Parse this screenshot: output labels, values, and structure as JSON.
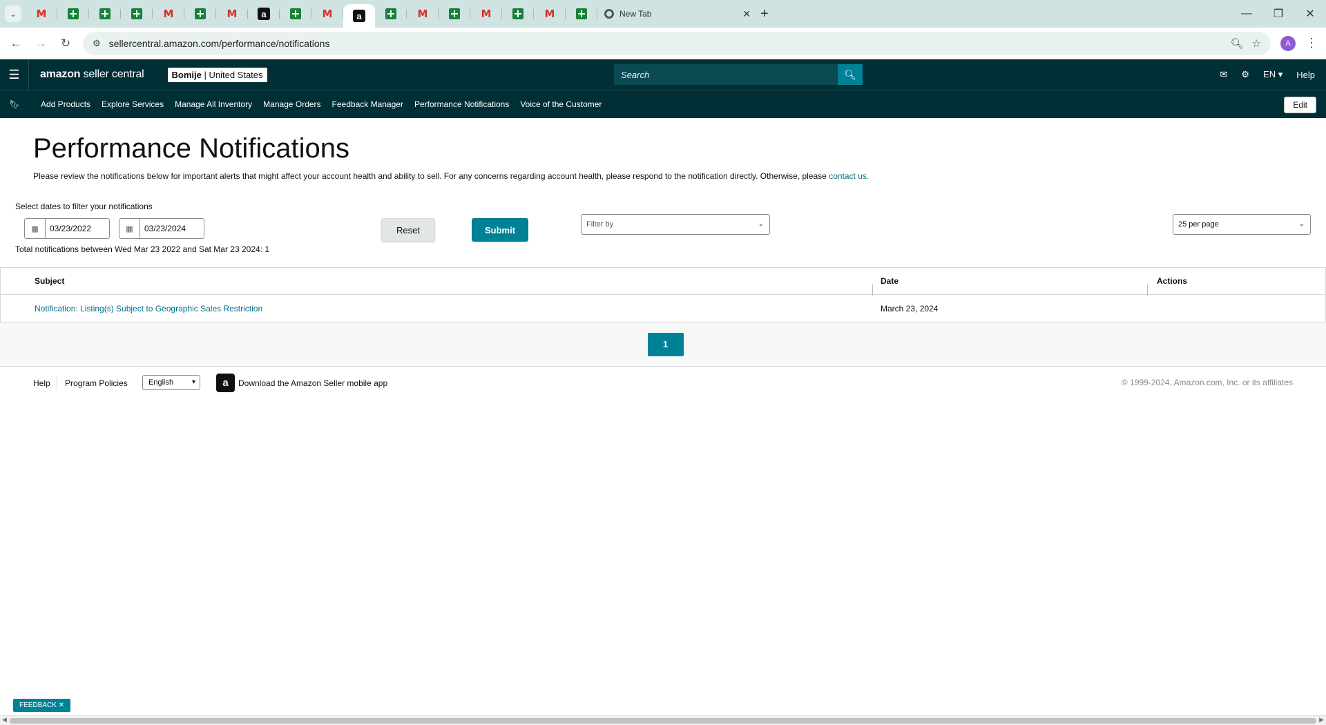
{
  "browser": {
    "tabs": [
      {
        "icon": "gmail-icon"
      },
      {
        "icon": "sheets-icon"
      },
      {
        "icon": "sheets-icon"
      },
      {
        "icon": "sheets-icon"
      },
      {
        "icon": "gmail-icon"
      },
      {
        "icon": "sheets-icon"
      },
      {
        "icon": "gmail-icon"
      },
      {
        "icon": "amazon-icon"
      },
      {
        "icon": "sheets-icon"
      },
      {
        "icon": "gmail-icon"
      },
      {
        "icon": "amazon-icon",
        "active": true
      },
      {
        "icon": "sheets-icon"
      },
      {
        "icon": "gmail-icon"
      },
      {
        "icon": "sheets-icon"
      },
      {
        "icon": "gmail-icon"
      },
      {
        "icon": "sheets-icon"
      },
      {
        "icon": "gmail-icon"
      },
      {
        "icon": "sheets-icon"
      }
    ],
    "new_tab_label": "New Tab",
    "url": "sellercentral.amazon.com/performance/notifications",
    "avatar_letter": "A"
  },
  "header": {
    "logo_bold": "amazon",
    "logo_light": " seller central",
    "account_store": "Bomije",
    "account_region": " | United States",
    "search_placeholder": "Search",
    "language": "EN",
    "help": "Help"
  },
  "nav": {
    "links": [
      "Add Products",
      "Explore Services",
      "Manage All Inventory",
      "Manage Orders",
      "Feedback Manager",
      "Performance Notifications",
      "Voice of the Customer"
    ],
    "edit_label": "Edit"
  },
  "page": {
    "title": "Performance Notifications",
    "intro": "Please review the notifications below for important alerts that might affect your account health and ability to sell. For any concerns regarding account health, please respond to the notification directly. Otherwise, please ",
    "intro_link": "contact us."
  },
  "filters": {
    "label": "Select dates to filter your notifications",
    "start_date": "03/23/2022",
    "end_date": "03/23/2024",
    "reset_label": "Reset",
    "submit_label": "Submit",
    "filter_placeholder": "Filter by",
    "per_page": "25 per page",
    "total_text": "Total notifications between Wed Mar 23 2022 and Sat Mar 23 2024: 1"
  },
  "table": {
    "columns": [
      "Subject",
      "Date",
      "Actions"
    ],
    "rows": [
      {
        "subject": "Notification: Listing(s) Subject to Geographic Sales Restriction",
        "date": "March 23, 2024",
        "actions": ""
      }
    ]
  },
  "pagination": {
    "current": "1"
  },
  "footer": {
    "help": "Help",
    "policies": "Program Policies",
    "language": "English",
    "app_text": "Download the Amazon Seller mobile app",
    "copyright": "© 1999-2024, Amazon.com, Inc. or its affiliates"
  },
  "feedback_label": "FEEDBACK ✕"
}
